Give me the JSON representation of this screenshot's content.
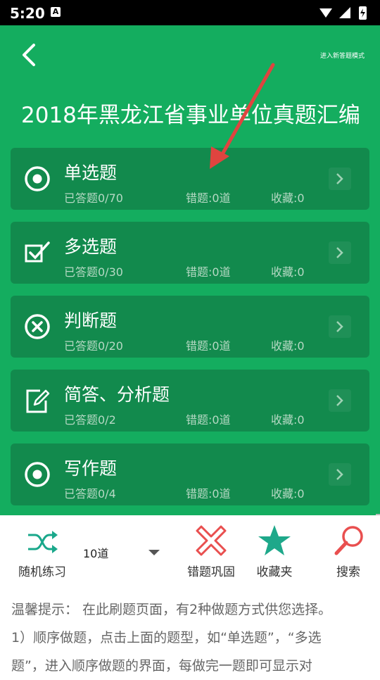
{
  "status_bar": {
    "time": "5:20",
    "a_badge": "A"
  },
  "header": {
    "new_mode_link": "进入新答题模式",
    "title": "2018年黑龙江省事业单位真题汇编"
  },
  "categories": [
    {
      "name": "单选题",
      "answered": "已答题0/70",
      "wrong": "错题:0道",
      "fav": "收藏:0",
      "icon": "radio-target-icon"
    },
    {
      "name": "多选题",
      "answered": "已答题0/30",
      "wrong": "错题:0道",
      "fav": "收藏:0",
      "icon": "checkbox-check-icon"
    },
    {
      "name": "判断题",
      "answered": "已答题0/20",
      "wrong": "错题:0道",
      "fav": "收藏:0",
      "icon": "circle-x-icon"
    },
    {
      "name": "简答、分析题",
      "answered": "已答题0/2",
      "wrong": "错题:0道",
      "fav": "收藏:0",
      "icon": "edit-pencil-icon"
    },
    {
      "name": "写作题",
      "answered": "已答题0/4",
      "wrong": "错题:0道",
      "fav": "收藏:0",
      "icon": "radio-target-icon"
    }
  ],
  "toolbar": {
    "random": "随机练习",
    "count_value": "10道",
    "wrong_review": "错题巩固",
    "favorites": "收藏夹",
    "search": "搜索"
  },
  "colors": {
    "primary_green": "#14ad5f",
    "card_green": "#128a4d",
    "accent_red": "#e94f4f",
    "star_teal": "#1ea88a",
    "arrow_red": "#e0443f"
  },
  "tips": {
    "line1": "温馨提示： 在此刷题页面，有2种做题方式供您选择。",
    "line2": "1）顺序做题，点击上面的题型，如“单选题”，“多选",
    "line3": "题”，进入顺序做题的界面，每做完一题即可显示对"
  }
}
